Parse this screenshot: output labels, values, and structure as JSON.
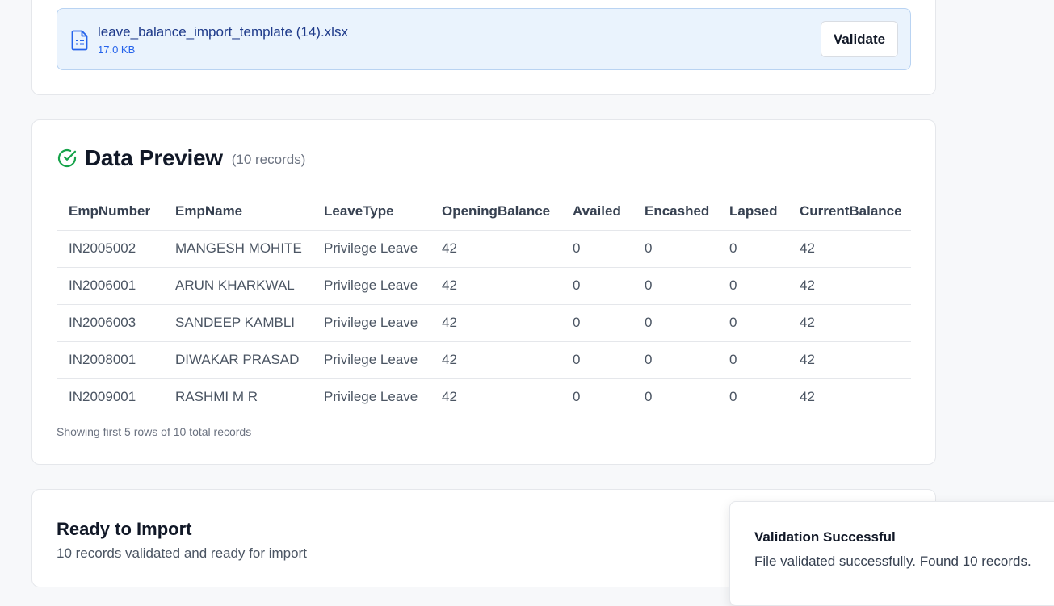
{
  "upload": {
    "file_name": "leave_balance_import_template (14).xlsx",
    "file_size": "17.0 KB",
    "file_icon": "spreadsheet-file-icon",
    "validate_label": "Validate"
  },
  "preview": {
    "title": "Data Preview",
    "record_count": "(10 records)",
    "status_icon": "check-circle-icon",
    "columns": [
      "EmpNumber",
      "EmpName",
      "LeaveType",
      "OpeningBalance",
      "Availed",
      "Encashed",
      "Lapsed",
      "CurrentBalance"
    ],
    "rows": [
      [
        "IN2005002",
        "MANGESH MOHITE",
        "Privilege Leave",
        "42",
        "0",
        "0",
        "0",
        "42"
      ],
      [
        "IN2006001",
        "ARUN KHARKWAL",
        "Privilege Leave",
        "42",
        "0",
        "0",
        "0",
        "42"
      ],
      [
        "IN2006003",
        "SANDEEP KAMBLI",
        "Privilege Leave",
        "42",
        "0",
        "0",
        "0",
        "42"
      ],
      [
        "IN2008001",
        "DIWAKAR PRASAD",
        "Privilege Leave",
        "42",
        "0",
        "0",
        "0",
        "42"
      ],
      [
        "IN2009001",
        "RASHMI M R",
        "Privilege Leave",
        "42",
        "0",
        "0",
        "0",
        "42"
      ]
    ],
    "footer_note": "Showing first 5 rows of 10 total records"
  },
  "import": {
    "title": "Ready to Import",
    "subtitle": "10 records validated and ready for import"
  },
  "toast": {
    "title": "Validation Successful",
    "message": "File validated successfully. Found 10 records."
  },
  "colors": {
    "success": "#16a34a",
    "file_box_bg": "#eaf3fd",
    "file_link": "#1e3a8a",
    "file_size": "#2563eb"
  }
}
